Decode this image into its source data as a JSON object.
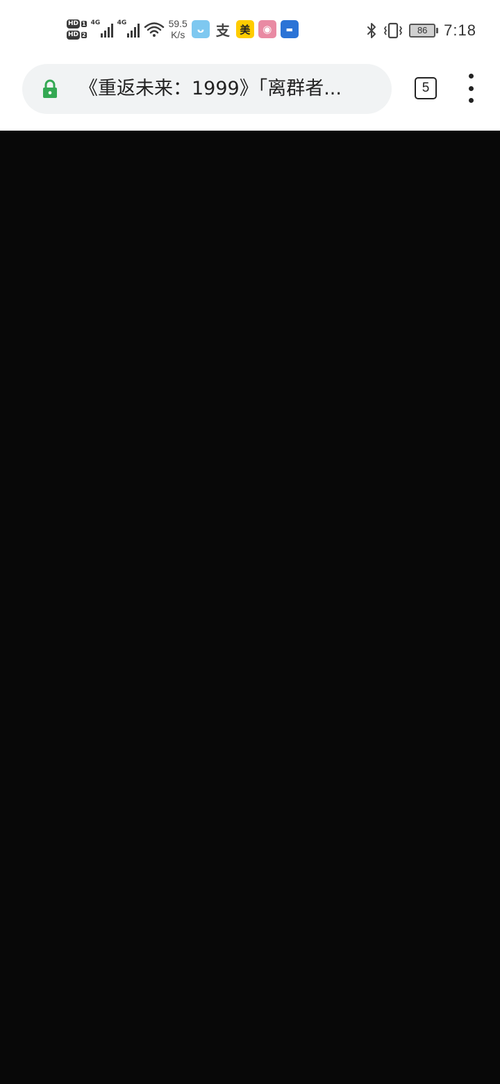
{
  "status_bar": {
    "sim1_label": "HD",
    "sim1_index": "1",
    "sim2_label": "HD",
    "sim2_index": "2",
    "signal1_label": "4G",
    "signal2_label": "4G",
    "net_speed_value": "59.5",
    "net_speed_unit": "K/s",
    "app_icons": [
      {
        "name": "app-notification-icon-1",
        "glyph": "ᴗ"
      },
      {
        "name": "app-notification-icon-2",
        "glyph": "支"
      },
      {
        "name": "app-notification-icon-3",
        "glyph": "美"
      },
      {
        "name": "app-notification-icon-4",
        "glyph": "◉"
      },
      {
        "name": "app-notification-icon-5",
        "glyph": "▬"
      }
    ],
    "battery_level": "86",
    "time": "7:18"
  },
  "browser": {
    "url_text": "《重返未来：1999》「离群者...",
    "tab_count": "5"
  },
  "colors": {
    "lock": "#34a853",
    "content_background": "#080808",
    "omnibox_background": "#f1f3f4"
  }
}
